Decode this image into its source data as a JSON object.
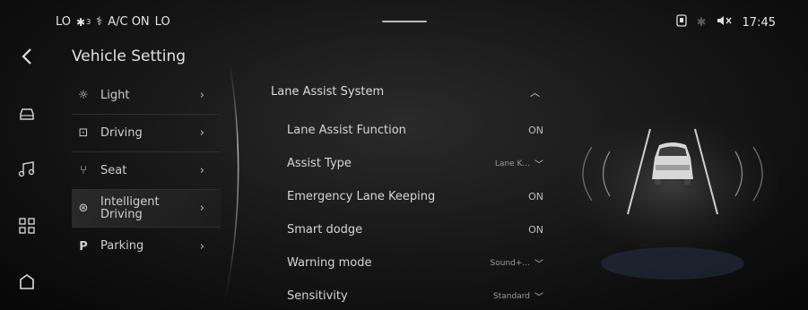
{
  "status": {
    "left_temp": "LO",
    "fan_glyph": "✱",
    "fan_level": "3",
    "ac_icon": "fan-blade-icon",
    "ac_label": "A/C ON",
    "right_temp": "LO",
    "time": "17:45",
    "icons": [
      "phone-link-icon",
      "bluetooth-icon",
      "volume-mute-icon"
    ]
  },
  "rail": {
    "icons": [
      "back-icon",
      "car-icon",
      "music-icon",
      "apps-grid-icon",
      "home-icon"
    ]
  },
  "vehicle_setting": {
    "title": "Vehicle Setting",
    "items": [
      {
        "label": "Light",
        "icon": "light-icon",
        "glyph": "☼"
      },
      {
        "label": "Driving",
        "icon": "steering-car-icon",
        "glyph": "⊡"
      },
      {
        "label": "Seat",
        "icon": "seat-icon",
        "glyph": "⑂"
      },
      {
        "label": "Intelligent Driving",
        "icon": "steering-wheel-icon",
        "glyph": "⊛"
      },
      {
        "label": "Parking",
        "icon": "parking-icon",
        "glyph": "P"
      }
    ]
  },
  "lane_assist": {
    "header": "Lane Assist System",
    "rows": [
      {
        "label": "Lane Assist Function",
        "value": "ON"
      },
      {
        "label": "Assist Type",
        "value": "Lane K..."
      },
      {
        "label": "Emergency Lane Keeping",
        "value": "ON"
      },
      {
        "label": "Smart dodge",
        "value": "ON"
      },
      {
        "label": "Warning mode",
        "value": "Sound+..."
      },
      {
        "label": "Sensitivity",
        "value": "Standard"
      }
    ]
  },
  "colors": {
    "background": "#151515",
    "text": "#d9d9d9",
    "accent_line": "#8a8a8a"
  }
}
